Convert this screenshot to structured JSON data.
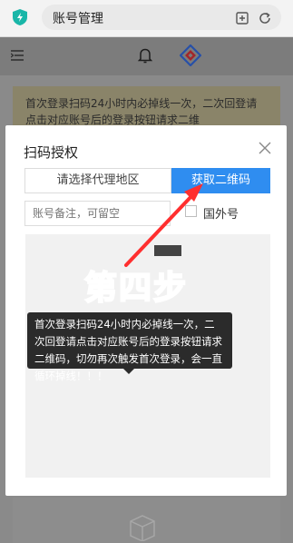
{
  "browser": {
    "url_title": "账号管理",
    "colors": {
      "shield": "#19b6a8"
    }
  },
  "page": {
    "notice_text": "首次登录扫码24小时内必掉线一次，二次回登请点击对应账号后的登录按钮请求二维"
  },
  "modal": {
    "title": "扫码授权",
    "region_select": "请选择代理地区",
    "qr_button": "获取二维码",
    "remark_placeholder": "账号备注，可留空",
    "overseas_label": "国外号",
    "accent_color": "#2f8df0"
  },
  "annotation": {
    "step_text": "第四步",
    "tooltip_text": "首次登录扫码24小时内必掉线一次，二次回登请点击对应账号后的登录按钮请求二维码，切勿再次触发首次登录，会一直循环掉线！！！"
  }
}
